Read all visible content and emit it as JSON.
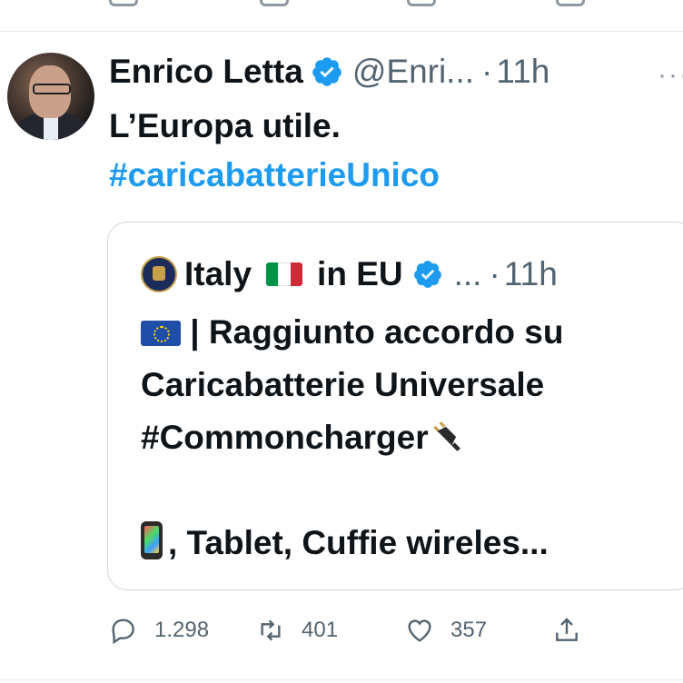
{
  "tweet": {
    "author_name": "Enrico Letta",
    "handle": "@Enri...",
    "time_sep": "·",
    "time": "11h",
    "more": "···",
    "text": "L’Europa utile.",
    "hashtag": "#caricabatterieUnico"
  },
  "quote": {
    "name_a": "Italy",
    "name_b": "in EU",
    "handle": "...",
    "time_sep": "·",
    "time": "11h",
    "line1": "| Raggiunto accordo su",
    "line2": "Caricabatterie Universale",
    "line3": "#Commoncharger",
    "line4": ", Tablet, Cuffie wireles..."
  },
  "actions": {
    "replies": "1.298",
    "retweets": "401",
    "likes": "357"
  },
  "colors": {
    "accent": "#1d9bf0",
    "muted": "#536471",
    "flag_green": "#009246",
    "flag_white": "#ffffff",
    "flag_red": "#ce2b37"
  },
  "icons": [
    "verified-badge-icon",
    "italy-flag-icon",
    "eu-flag-icon",
    "plug-icon",
    "mobile-phone-icon",
    "reply-icon",
    "retweet-icon",
    "like-icon",
    "share-icon"
  ]
}
